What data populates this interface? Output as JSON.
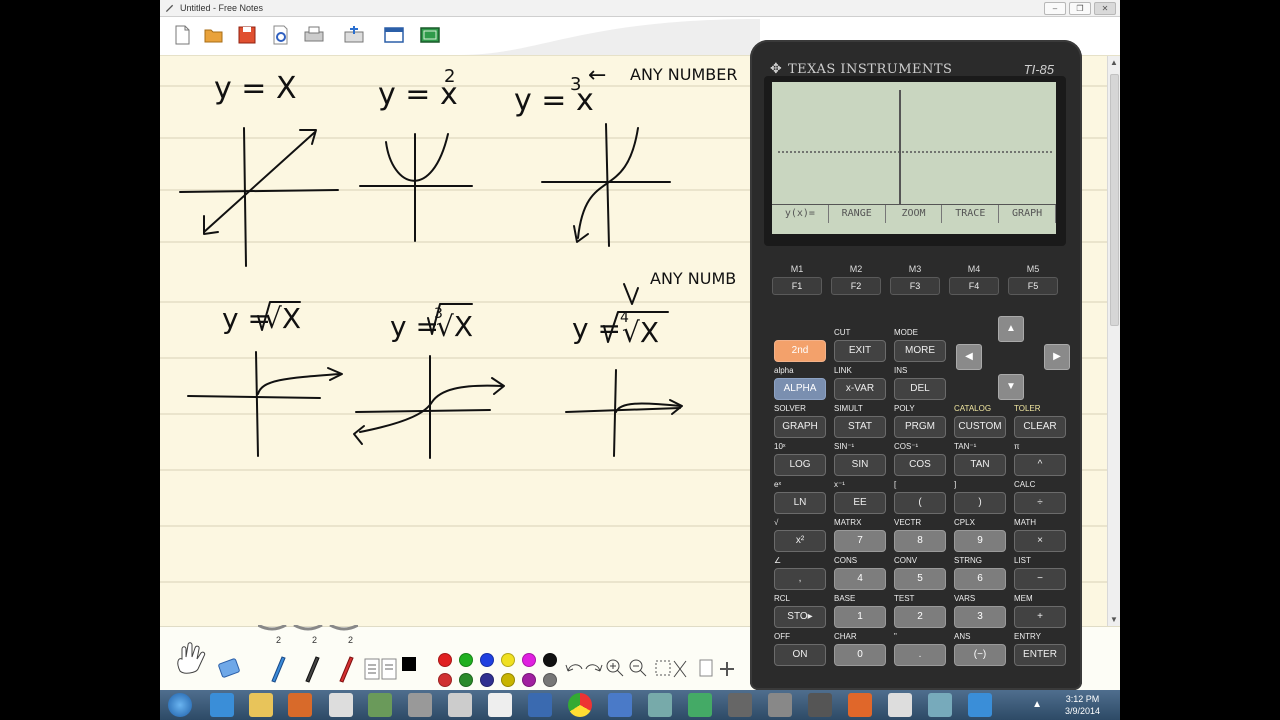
{
  "window": {
    "title": "Untitled - Free Notes",
    "controls": [
      "minimize",
      "restore",
      "close"
    ]
  },
  "toolbar": {
    "buttons": [
      "new-note-icon",
      "open-folder-icon",
      "save-icon",
      "print-preview-icon",
      "print-icon",
      "export-icon",
      "window-icon",
      "green-board-icon"
    ]
  },
  "notes": {
    "handwriting": {
      "eq1": "y = X",
      "eq2": "y = x",
      "eq2_exp": "2",
      "eq3": "y = x",
      "eq3_exp": "3",
      "eq3_note_arrow": "←",
      "eq3_note": "ANY NUMBER",
      "eq4_prefix": "y = ",
      "eq4_radical": "√X",
      "eq5_prefix": "y = ",
      "eq5_index": "3",
      "eq5_radical": "√X",
      "eq6_prefix": "y = ",
      "eq6_index": "4",
      "eq6_radical": "√X",
      "eq6_note": "ANY NUMB"
    }
  },
  "bottom": {
    "pen_sizes": [
      "2",
      "2",
      "2"
    ],
    "colors": [
      "#000000",
      "#e02020",
      "#20b020",
      "#2040e0",
      "#f0e020",
      "#e020e0",
      "#111111",
      "#d03030",
      "#2a8a2a",
      "#303090",
      "#c8b400",
      "#a020a0",
      "#777777"
    ]
  },
  "taskbar": {
    "time": "3:12 PM",
    "date": "3/9/2014",
    "tray_arrow": "▲"
  },
  "calculator": {
    "brand": "TEXAS INSTRUMENTS",
    "model": "TI-85",
    "menu": [
      "y(x)=",
      "RANGE",
      "ZOOM",
      "TRACE",
      "GRAPH"
    ],
    "fkeys": [
      {
        "top": "M1",
        "key": "F1"
      },
      {
        "top": "M2",
        "key": "F2"
      },
      {
        "top": "M3",
        "key": "F3"
      },
      {
        "top": "M4",
        "key": "F4"
      },
      {
        "top": "M5",
        "key": "F5"
      }
    ],
    "rows": [
      {
        "labels": [
          "",
          "CUT",
          "MODE",
          "",
          ""
        ],
        "keys": [
          "2nd",
          "EXIT",
          "MORE",
          "",
          ""
        ]
      },
      {
        "labels": [
          "alpha",
          "LINK",
          "INS",
          "",
          ""
        ],
        "keys": [
          "ALPHA",
          "x-VAR",
          "DEL",
          "",
          ""
        ]
      },
      {
        "labels": [
          "SOLVER",
          "SIMULT",
          "POLY",
          "CATALOG",
          "TOLER"
        ],
        "keys": [
          "GRAPH",
          "STAT",
          "PRGM",
          "CUSTOM",
          "CLEAR"
        ]
      },
      {
        "labels": [
          "10ˣ",
          "SIN⁻¹",
          "COS⁻¹",
          "TAN⁻¹",
          "π"
        ],
        "keys": [
          "LOG",
          "SIN",
          "COS",
          "TAN",
          "^"
        ]
      },
      {
        "labels": [
          "eˣ",
          "x⁻¹",
          "[",
          "]",
          "CALC"
        ],
        "keys": [
          "LN",
          "EE",
          "(",
          ")",
          "÷"
        ]
      },
      {
        "labels": [
          "√",
          "MATRX",
          "VECTR",
          "CPLX",
          "MATH"
        ],
        "keys": [
          "x²",
          "7",
          "8",
          "9",
          "×"
        ]
      },
      {
        "labels": [
          "∠",
          "CONS",
          "CONV",
          "STRNG",
          "LIST"
        ],
        "keys": [
          ",",
          "4",
          "5",
          "6",
          "−"
        ]
      },
      {
        "labels": [
          "RCL",
          "BASE",
          "TEST",
          "VARS",
          "MEM"
        ],
        "keys": [
          "STO▸",
          "1",
          "2",
          "3",
          "+"
        ]
      },
      {
        "labels": [
          "OFF",
          "CHAR",
          "\"",
          "ANS",
          "ENTRY"
        ],
        "keys": [
          "ON",
          "0",
          ".",
          "(−)",
          "ENTER"
        ]
      }
    ]
  }
}
